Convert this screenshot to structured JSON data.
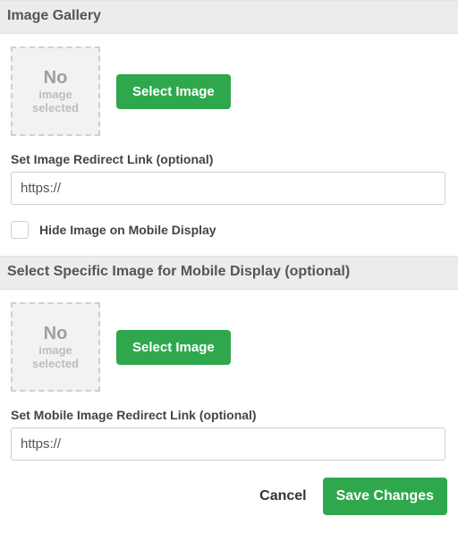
{
  "section1": {
    "header": "Image Gallery",
    "placeholder": {
      "l1": "No",
      "l2": "image",
      "l3": "selected"
    },
    "select_button": "Select Image",
    "redirect_label": "Set Image Redirect Link (optional)",
    "redirect_value": "https://",
    "hide_checkbox_label": "Hide Image on Mobile Display"
  },
  "section2": {
    "header": "Select Specific Image for Mobile Display (optional)",
    "placeholder": {
      "l1": "No",
      "l2": "image",
      "l3": "selected"
    },
    "select_button": "Select Image",
    "redirect_label": "Set Mobile Image Redirect Link (optional)",
    "redirect_value": "https://"
  },
  "footer": {
    "cancel": "Cancel",
    "save": "Save Changes"
  }
}
